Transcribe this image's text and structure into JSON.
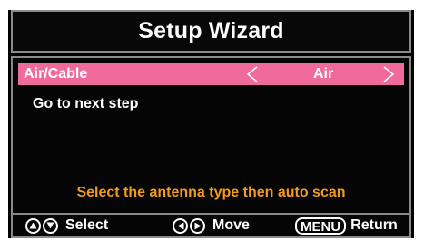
{
  "header": {
    "title": "Setup Wizard"
  },
  "menu": {
    "items": [
      {
        "label": "Air/Cable",
        "value": "Air",
        "selected": true
      },
      {
        "label": "Go to next step",
        "selected": false
      }
    ]
  },
  "hint": "Select the antenna type then auto scan",
  "footer": {
    "select_label": "Select",
    "move_label": "Move",
    "menu_key": "MENU",
    "return_label": "Return"
  },
  "colors": {
    "highlight": "#f06b9b",
    "hint": "#f29a1c",
    "background": "#000000",
    "border": "#8a8a8a"
  },
  "icons": {
    "left": "chevron-left-icon",
    "right": "chevron-right-icon",
    "up": "up-triangle-icon",
    "down": "down-triangle-icon"
  }
}
